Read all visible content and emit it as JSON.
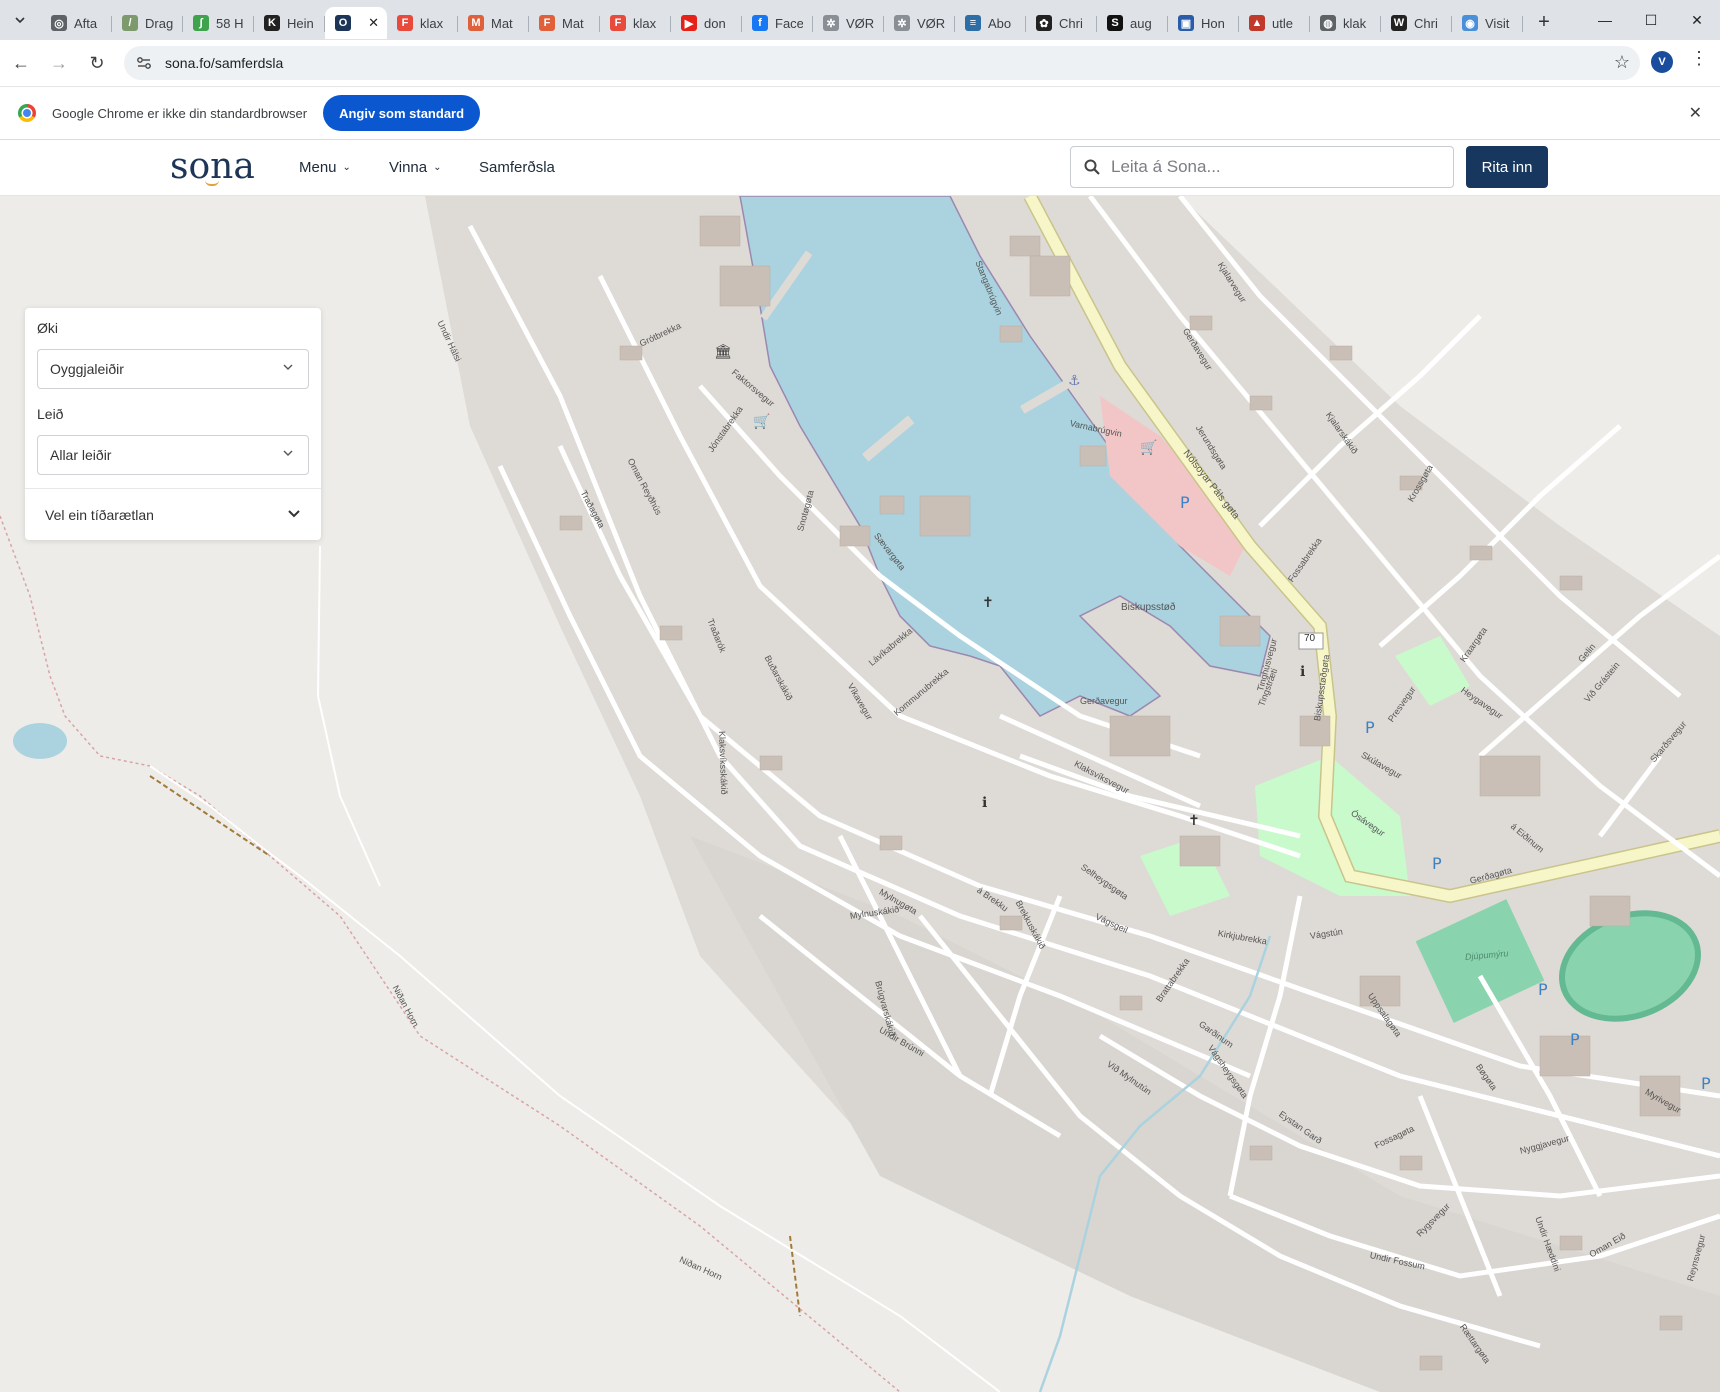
{
  "browser": {
    "tabs": [
      {
        "title": "Afta",
        "color": "#5f6368",
        "glyph": "◎"
      },
      {
        "title": "Drag",
        "color": "#7c9a6b",
        "glyph": "/"
      },
      {
        "title": "58 H",
        "color": "#3fa34d",
        "glyph": "∫"
      },
      {
        "title": "Hein",
        "color": "#222222",
        "glyph": "K"
      },
      {
        "title": "",
        "color": "#1d3557",
        "glyph": "O",
        "active": true
      },
      {
        "title": "klax",
        "color": "#e84a3c",
        "glyph": "F"
      },
      {
        "title": "Mat",
        "color": "#e0603c",
        "glyph": "M"
      },
      {
        "title": "Mat",
        "color": "#e0603c",
        "glyph": "F"
      },
      {
        "title": "klax",
        "color": "#e84a3c",
        "glyph": "F"
      },
      {
        "title": "don",
        "color": "#e62117",
        "glyph": "▶"
      },
      {
        "title": "Face",
        "color": "#1877f2",
        "glyph": "f"
      },
      {
        "title": "VØR",
        "color": "#8a8f96",
        "glyph": "✲"
      },
      {
        "title": "VØR",
        "color": "#8a8f96",
        "glyph": "✲"
      },
      {
        "title": "Abo",
        "color": "#2e6ea7",
        "glyph": "≡"
      },
      {
        "title": "Chri",
        "color": "#222222",
        "glyph": "✿"
      },
      {
        "title": "aug",
        "color": "#111111",
        "glyph": "S"
      },
      {
        "title": "Hon",
        "color": "#2a5caa",
        "glyph": "▣"
      },
      {
        "title": "utle",
        "color": "#c0392b",
        "glyph": "▲"
      },
      {
        "title": "klak",
        "color": "#5f6368",
        "glyph": "◍"
      },
      {
        "title": "Chri",
        "color": "#222222",
        "glyph": "W"
      },
      {
        "title": "Visit",
        "color": "#4a90d9",
        "glyph": "◉"
      }
    ],
    "url": "sona.fo/samferdsla",
    "profile_initial": "V"
  },
  "infobar": {
    "message": "Google Chrome er ikke din standardbrowser",
    "button_label": "Angiv som standard"
  },
  "site": {
    "logo": "sona",
    "nav": {
      "menu": "Menu",
      "work": "Vinna",
      "transport": "Samferðsla"
    },
    "search_placeholder": "Leita á Sona...",
    "login_label": "Rita inn"
  },
  "filter_panel": {
    "area_label": "Øki",
    "area_value": "Oyggjaleiðir",
    "route_label": "Leið",
    "route_value": "Allar leiðir",
    "timetable_label": "Vel ein tíðarætlan"
  },
  "map": {
    "colors": {
      "land": "#edece8",
      "residential": "#dedad5",
      "water": "#aad3df",
      "road_major": "#f7f6c8",
      "road_minor": "#ffffff",
      "park": "#c8facc",
      "pitch": "#8ad3af",
      "pedestrian": "#f2c6c6",
      "building": "#c9bfb6"
    },
    "labels": [
      {
        "text": "Nólsoyar Páls gøta"
      },
      {
        "text": "Biskupsstøð"
      },
      {
        "text": "Klaksvíksvegur"
      },
      {
        "text": "Biskupsstøðgøta"
      },
      {
        "text": "Gerðagøta"
      },
      {
        "text": "Djúpumýru"
      },
      {
        "text": "Niðan Horn"
      },
      {
        "text": "Niðan Horn"
      },
      {
        "text": "Undir Fossum"
      },
      {
        "text": "Undir Brúnni"
      },
      {
        "text": "Kirkjubrekka"
      },
      {
        "text": "Vágstún"
      },
      {
        "text": "Mylnugøta"
      },
      {
        "text": "Uppsalagøta"
      },
      {
        "text": "Víkavegur"
      },
      {
        "text": "Sævargøta"
      },
      {
        "text": "Faktorsvegur"
      },
      {
        "text": "Jónstabrekka"
      },
      {
        "text": "Grótbrekka"
      },
      {
        "text": "Undir Hálsi"
      },
      {
        "text": "Traðagøta"
      },
      {
        "text": "Gerðavegur"
      },
      {
        "text": "Kjalarvegur"
      },
      {
        "text": "Fossagøta"
      },
      {
        "text": "Bøgøta"
      },
      {
        "text": "Eystan Garð"
      },
      {
        "text": "Við Mylnutún"
      },
      {
        "text": "Nyggjavegur"
      },
      {
        "text": "Ósávegur"
      },
      {
        "text": "Skúlavegur"
      },
      {
        "text": "Presvegur"
      },
      {
        "text": "Varnabrúgvin"
      },
      {
        "text": "Stangabrúgvin"
      },
      {
        "text": "Heygavegur"
      },
      {
        "text": "Oman Eið"
      },
      {
        "text": "Rættargøta"
      },
      {
        "text": "Rygsvegur"
      },
      {
        "text": "Brattabrekka"
      },
      {
        "text": "Selheygsgøta"
      },
      {
        "text": "Garðinum"
      },
      {
        "text": "Vágsheygsgøta"
      },
      {
        "text": "Lávíkabrekka"
      },
      {
        "text": "Kommunubrekka"
      },
      {
        "text": "Buðarskákið"
      },
      {
        "text": "Klaksvíksskákið"
      },
      {
        "text": "Oman Reyðhús"
      },
      {
        "text": "Traðarók"
      },
      {
        "text": "Gerðavegur"
      },
      {
        "text": "Mylnuskákið"
      },
      {
        "text": "á Brekku"
      },
      {
        "text": "Vágsgeil"
      },
      {
        "text": "Brekkuskákið"
      },
      {
        "text": "Brúgvarskákið"
      },
      {
        "text": "Tinghúsvegur"
      },
      {
        "text": "Skarðsvegur"
      },
      {
        "text": "á Eiðinum"
      },
      {
        "text": "Jerundsgøta"
      },
      {
        "text": "Kjalarskákið"
      },
      {
        "text": "Krossgøta"
      },
      {
        "text": "Kraargøta"
      },
      {
        "text": "Fossabrekka"
      },
      {
        "text": "Undir Hæddini"
      },
      {
        "text": "Myrivegur"
      },
      {
        "text": "Reynsvegur"
      },
      {
        "text": "Gelin"
      },
      {
        "text": "Við Grástein"
      },
      {
        "text": "Tingstræti"
      },
      {
        "text": "Snotøgøta"
      },
      {
        "text": "70"
      }
    ]
  }
}
